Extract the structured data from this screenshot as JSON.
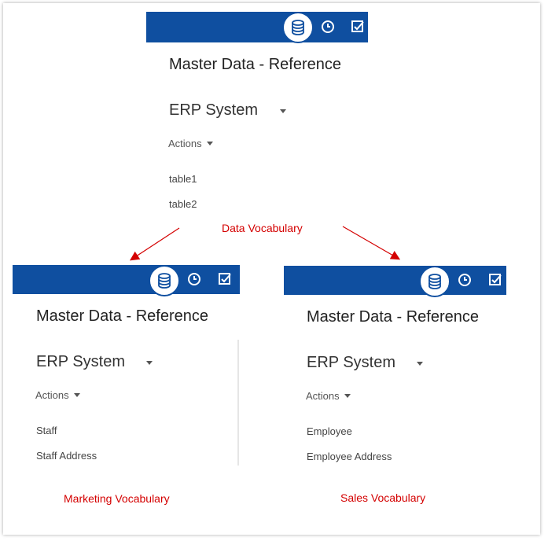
{
  "colors": {
    "bar": "#0f4fa0",
    "annotation": "#d40000"
  },
  "icons": [
    "database-icon",
    "history-clock-icon",
    "checkbox-icon"
  ],
  "top_panel": {
    "title": "Master Data - Reference",
    "system": "ERP System",
    "actions_label": "Actions",
    "items": [
      "table1",
      "table2"
    ]
  },
  "left_panel": {
    "title": "Master Data - Reference",
    "system": "ERP System",
    "actions_label": "Actions",
    "items": [
      "Staff",
      "Staff Address"
    ]
  },
  "right_panel": {
    "title": "Master Data - Reference",
    "system": "ERP System",
    "actions_label": "Actions",
    "items": [
      "Employee",
      "Employee Address"
    ]
  },
  "annotations": {
    "center": "Data Vocabulary",
    "left": "Marketing Vocabulary",
    "right": "Sales Vocabulary"
  }
}
